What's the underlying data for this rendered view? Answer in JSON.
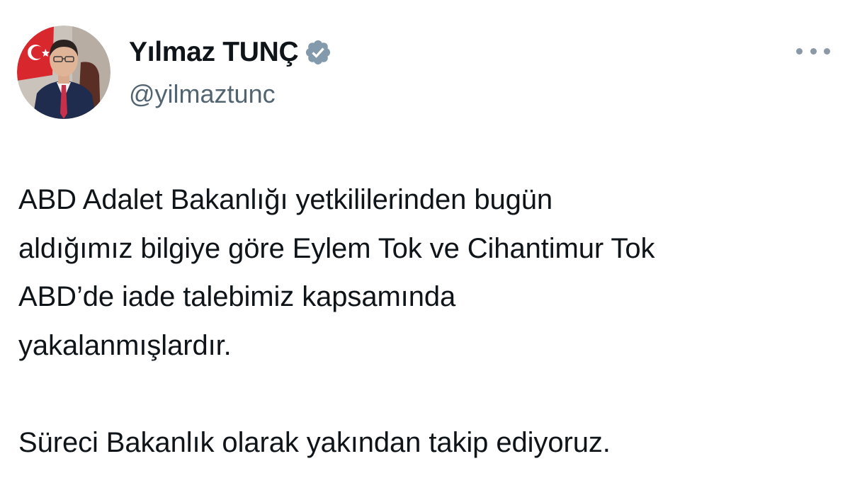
{
  "author": {
    "display_name": "Yılmaz TUNÇ",
    "handle": "@yilmaztunc",
    "verified": true,
    "verified_badge_color": "#829aab"
  },
  "tweet": {
    "paragraph1": [
      "ABD Adalet Bakanlığı yetkililerinden bugün",
      "aldığımız bilgiye göre Eylem Tok ve Cihantimur Tok",
      "ABD’de iade talebimiz kapsamında",
      "yakalanmışlardır."
    ],
    "paragraph2": [
      "Süreci Bakanlık olarak yakından takip ediyoruz."
    ]
  },
  "icons": {
    "more": "more-horizontal-icon",
    "verified": "verified-badge-icon"
  },
  "colors": {
    "text_primary": "#0f1419",
    "text_secondary": "#536471",
    "background": "#ffffff"
  }
}
